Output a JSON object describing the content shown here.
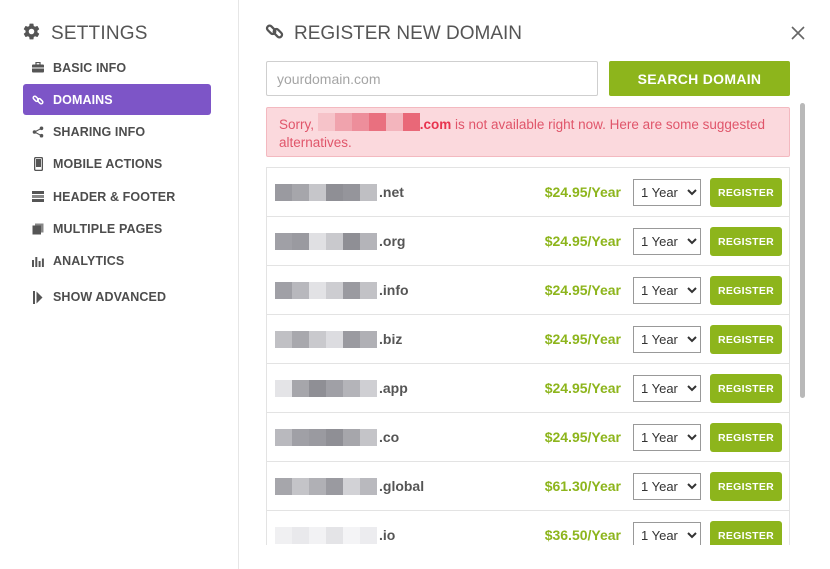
{
  "sidebar": {
    "title": "SETTINGS",
    "title_icon": "gear-icon",
    "items": [
      {
        "label": "BASIC INFO",
        "icon": "briefcase-icon",
        "active": false
      },
      {
        "label": "DOMAINS",
        "icon": "link-icon",
        "active": true
      },
      {
        "label": "SHARING INFO",
        "icon": "share-icon",
        "active": false
      },
      {
        "label": "MOBILE ACTIONS",
        "icon": "mobile-icon",
        "active": false
      },
      {
        "label": "HEADER & FOOTER",
        "icon": "header-footer-icon",
        "active": false
      },
      {
        "label": "MULTIPLE PAGES",
        "icon": "pages-icon",
        "active": false
      },
      {
        "label": "ANALYTICS",
        "icon": "bar-chart-icon",
        "active": false
      },
      {
        "label": "SHOW ADVANCED",
        "icon": "expand-icon",
        "active": false
      }
    ],
    "active_color": "#7d55c7"
  },
  "header": {
    "title": "REGISTER NEW DOMAIN",
    "icon": "link-icon",
    "close_icon": "close-icon"
  },
  "search": {
    "placeholder": "yourdomain.com",
    "value": "",
    "button_label": "SEARCH DOMAIN"
  },
  "alert": {
    "prefix": "Sorry, ",
    "domain_tld": ".com",
    "message": " is not available right now. Here are some suggested alternatives."
  },
  "results": [
    {
      "tld": ".net",
      "price": "$24.95/Year",
      "term": "1 Year",
      "button": "REGISTER"
    },
    {
      "tld": ".org",
      "price": "$24.95/Year",
      "term": "1 Year",
      "button": "REGISTER"
    },
    {
      "tld": ".info",
      "price": "$24.95/Year",
      "term": "1 Year",
      "button": "REGISTER"
    },
    {
      "tld": ".biz",
      "price": "$24.95/Year",
      "term": "1 Year",
      "button": "REGISTER"
    },
    {
      "tld": ".app",
      "price": "$24.95/Year",
      "term": "1 Year",
      "button": "REGISTER"
    },
    {
      "tld": ".co",
      "price": "$24.95/Year",
      "term": "1 Year",
      "button": "REGISTER"
    },
    {
      "tld": ".global",
      "price": "$61.30/Year",
      "term": "1 Year",
      "button": "REGISTER"
    },
    {
      "tld": ".io",
      "price": "$36.50/Year",
      "term": "1 Year",
      "button": "REGISTER"
    }
  ],
  "colors": {
    "accent_green": "#8db51c",
    "alert_bg": "#fbd9dd",
    "alert_text": "#e0556a"
  }
}
